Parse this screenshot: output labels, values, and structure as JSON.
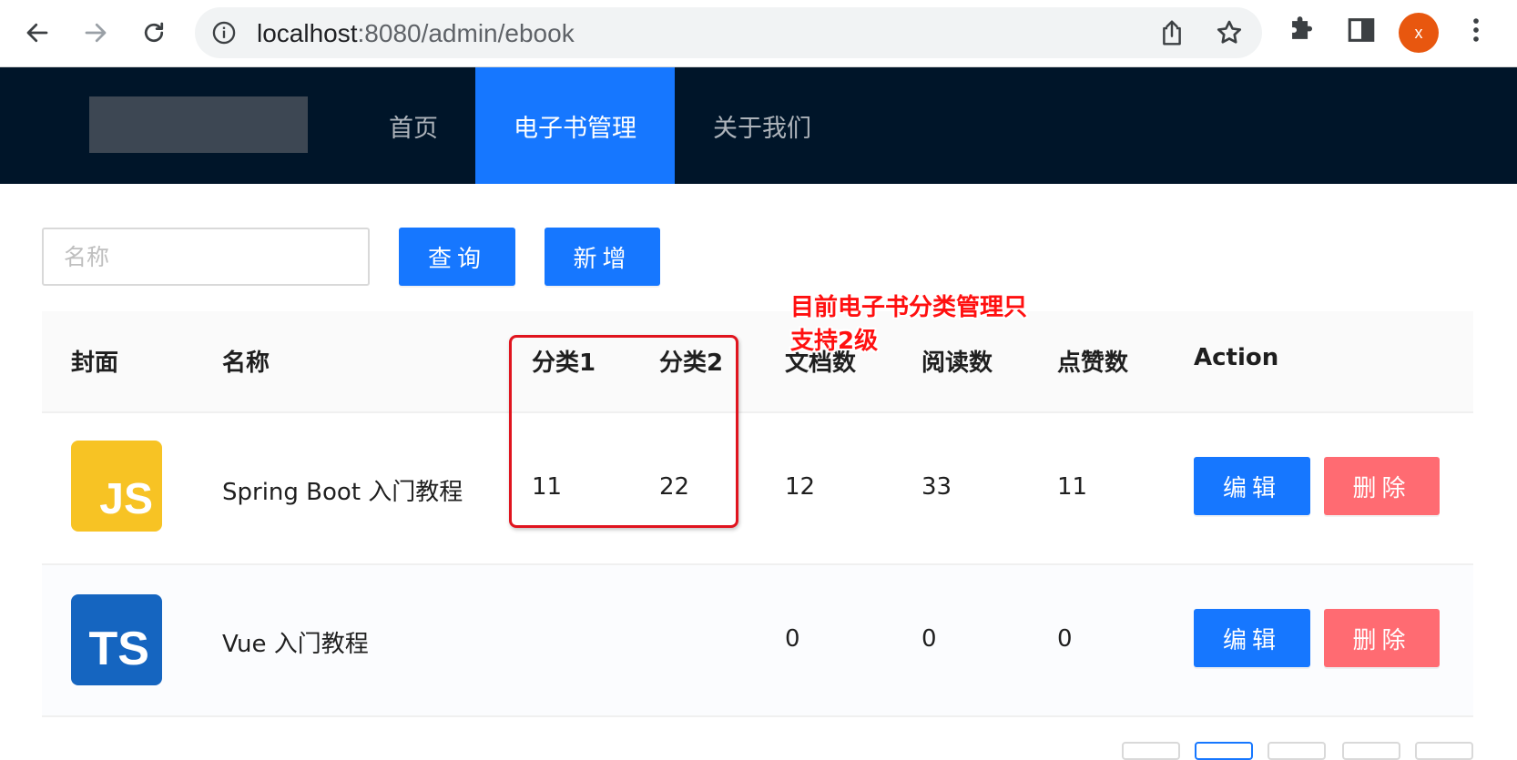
{
  "browser": {
    "url_host": "localhost",
    "url_path": ":8080/admin/ebook",
    "profile_initial": "x"
  },
  "header": {
    "menu": [
      {
        "label": "首页"
      },
      {
        "label": "电子书管理"
      },
      {
        "label": "关于我们"
      }
    ],
    "active_menu": 1
  },
  "toolbar": {
    "search_placeholder": "名称",
    "search_value": "",
    "query_label": "查询",
    "add_label": "新增"
  },
  "table": {
    "columns": [
      "封面",
      "名称",
      "分类1",
      "分类2",
      "文档数",
      "阅读数",
      "点赞数",
      "Action"
    ],
    "rows": [
      {
        "cover": "JS",
        "name": "Spring Boot 入门教程",
        "category1": "11",
        "category2": "22",
        "doc_count": "12",
        "view_count": "33",
        "vote_count": "11",
        "edit_label": "编辑",
        "delete_label": "删除"
      },
      {
        "cover": "TS",
        "name": "Vue 入门教程",
        "category1": "",
        "category2": "",
        "doc_count": "0",
        "view_count": "0",
        "vote_count": "0",
        "edit_label": "编辑",
        "delete_label": "删除"
      }
    ]
  },
  "annotation": {
    "line1": "目前电子书分类管理只",
    "line2": "支持2级"
  },
  "colors": {
    "header_bg": "#001529",
    "primary": "#1677ff",
    "danger": "#ff6b72",
    "annotation_red": "#e0141e",
    "js_cover": "#f7c324",
    "ts_cover": "#1565c0"
  }
}
